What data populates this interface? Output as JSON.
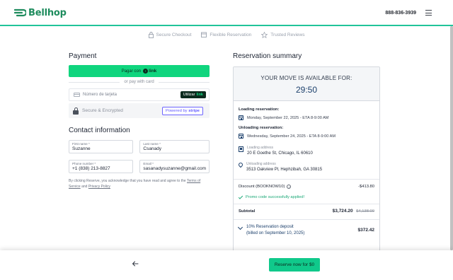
{
  "header": {
    "brand": "Bellhop",
    "phone": "888-836-3939"
  },
  "trust": {
    "items": [
      "Secure Checkout",
      "Flexible Reservation",
      "Trusted Reviews"
    ]
  },
  "payment": {
    "title": "Payment",
    "link_button_prefix": "Pagar con",
    "link_button_brand": "link",
    "divider": "or pay with card",
    "card_placeholder": "Número de tarjeta",
    "use_link_prefix": "Utilizar",
    "use_link_brand": "link",
    "secure_text": "Secure & Encrypted",
    "powered_by": "Powered by",
    "stripe": "stripe"
  },
  "contact": {
    "title": "Contact information",
    "first_name_label": "First name *",
    "first_name": "Suzanne",
    "last_name_label": "Last name *",
    "last_name": "Csanady",
    "phone_label": "Phone number *",
    "phone": "+1 (838) 213-8827",
    "email_label": "Email *",
    "email": "sasanadysuzanne@gmail.com",
    "disclaimer_pre": "By clicking Reserve, you acknowledge that you have read and agree to the",
    "terms": "Terms of Service",
    "and": "and",
    "privacy": "Privacy Policy"
  },
  "summary": {
    "title": "Reservation summary",
    "timer_label": "YOUR MOVE IS AVAILABLE FOR:",
    "timer": "29:50",
    "loading_label": "Loading reservation:",
    "loading_date": "Monday, September 22, 2025 - ETA 8-9:00 AM",
    "unloading_label": "Unloading reservation:",
    "unloading_date": "Wednesday, September 24, 2025 - ETA 8-9:00 AM",
    "loading_address_label": "Loading address",
    "loading_address": "20 E Goethe St, Chicago, IL 60610",
    "unloading_address_label": "Unloading address",
    "unloading_address": "3513 Oakview Pl, Hephzibah, GA 30815",
    "discount_label": "Discount (BOOKNOW10)",
    "discount_value": "-$413.80",
    "promo_success": "Promo code successfully applied!",
    "subtotal_label": "Subtotal",
    "subtotal": "$3,724.20",
    "subtotal_original": "$4,138.00",
    "deposit_label": "10% Reservation deposit",
    "deposit_note": "(billed on September 10, 2025)",
    "deposit_value": "$372.42"
  },
  "footer": {
    "reserve_label": "Reserve now for $0"
  },
  "colors": {
    "brand_green": "#21c49a",
    "link_green": "#10d57e",
    "navy": "#1b3f6b",
    "stripe": "#635bff"
  }
}
